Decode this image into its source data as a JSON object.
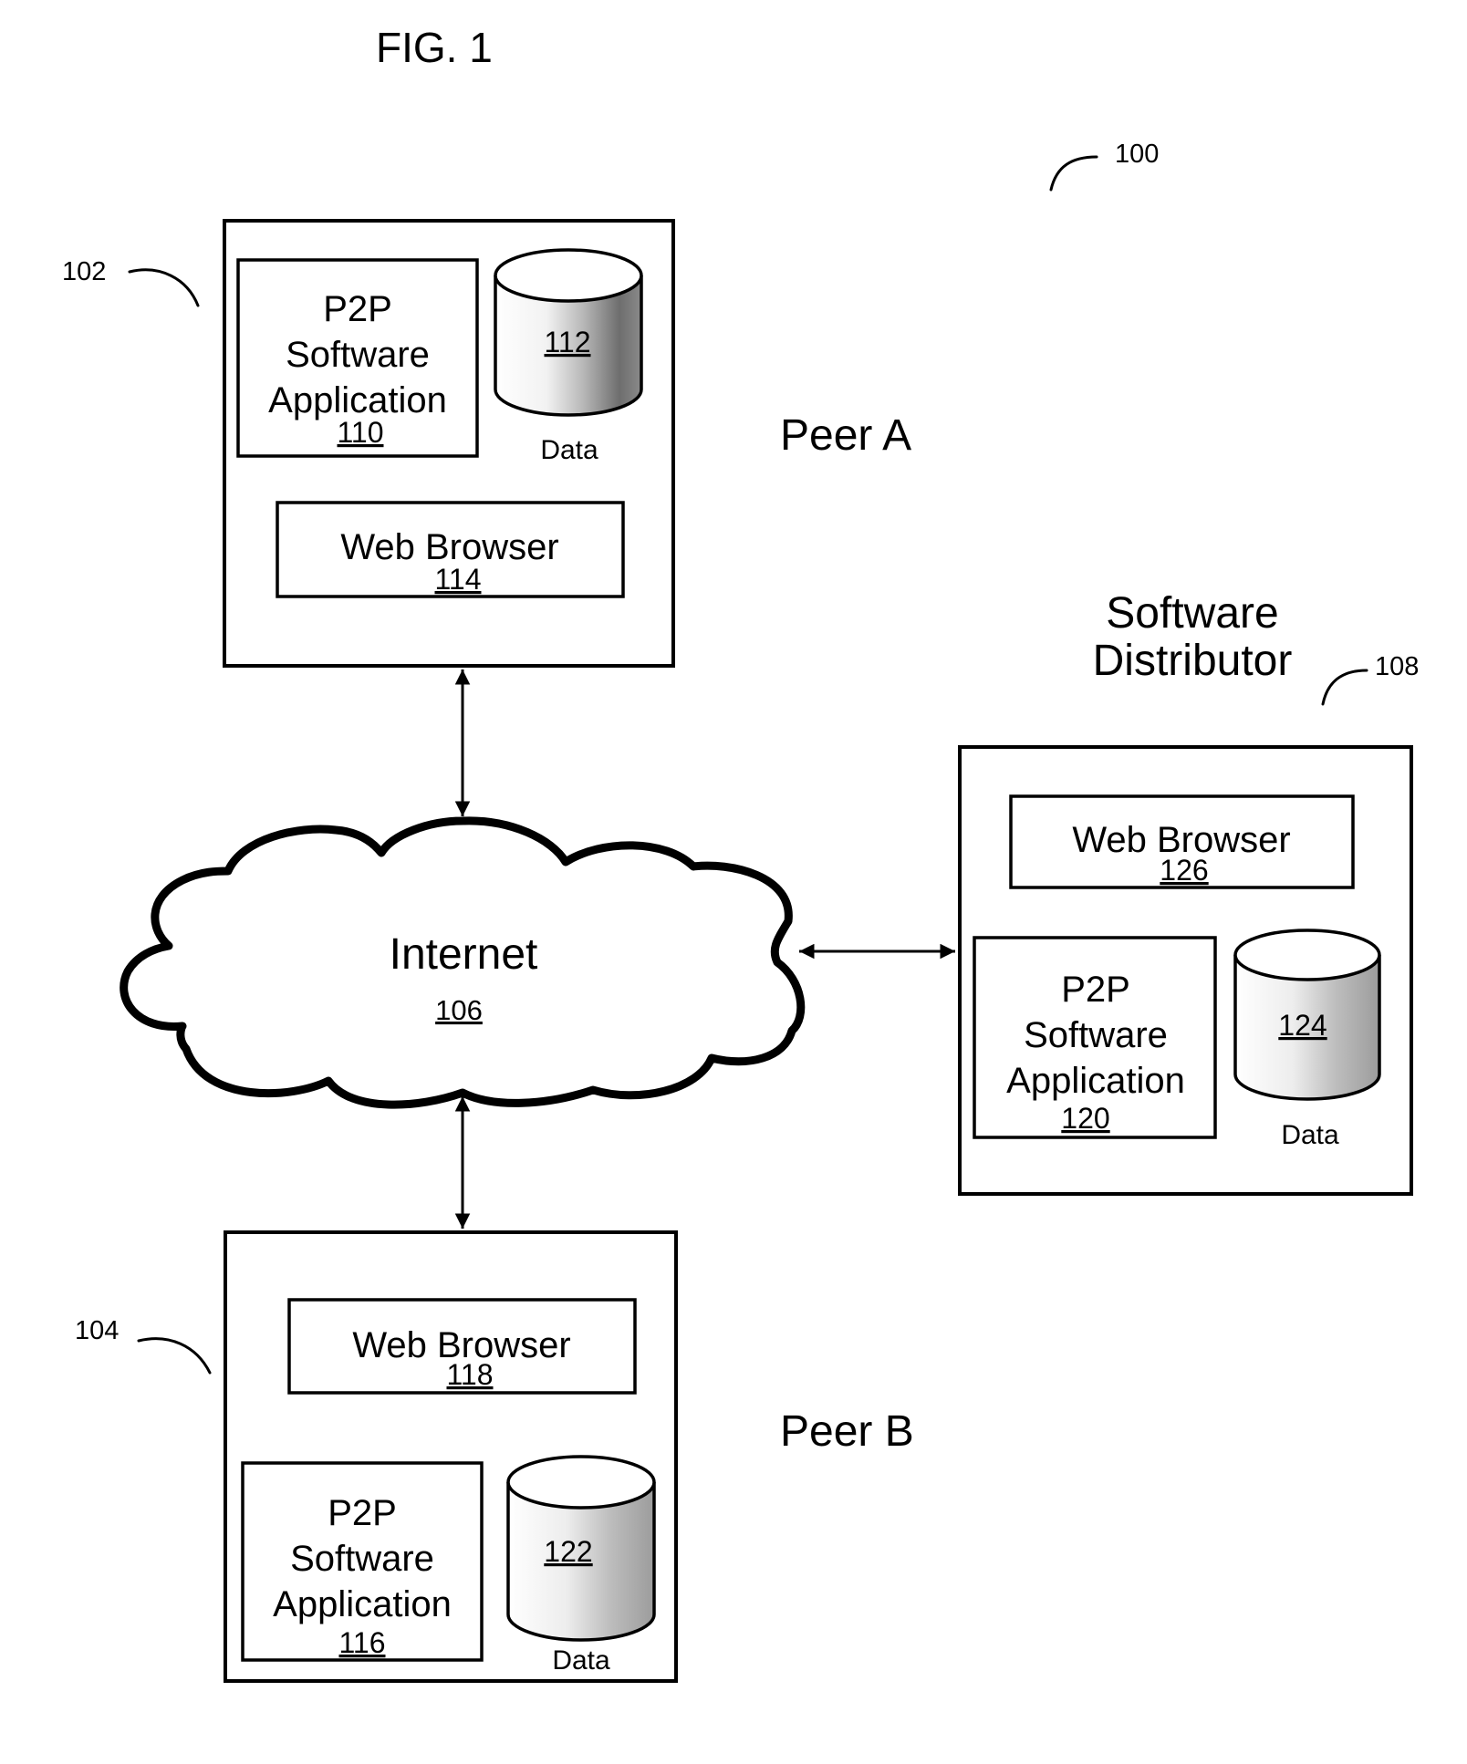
{
  "figure": {
    "title": "FIG. 1",
    "system_ref": "100"
  },
  "internet": {
    "label": "Internet",
    "ref": "106"
  },
  "peer_a": {
    "name": "Peer A",
    "ref": "102",
    "p2p_app": {
      "lines": [
        "P2P",
        "Software",
        "Application"
      ],
      "ref": "110"
    },
    "data_store": {
      "ref": "112",
      "caption": "Data"
    },
    "web_browser": {
      "label": "Web Browser",
      "ref": "114"
    }
  },
  "peer_b": {
    "name": "Peer B",
    "ref": "104",
    "web_browser": {
      "label": "Web Browser",
      "ref": "118"
    },
    "p2p_app": {
      "lines": [
        "P2P",
        "Software",
        "Application"
      ],
      "ref": "116"
    },
    "data_store": {
      "ref": "122",
      "caption": "Data"
    }
  },
  "distributor": {
    "name_lines": [
      "Software",
      "Distributor"
    ],
    "ref": "108",
    "web_browser": {
      "label": "Web Browser",
      "ref": "126"
    },
    "p2p_app": {
      "lines": [
        "P2P",
        "Software",
        "Application"
      ],
      "ref": "120"
    },
    "data_store": {
      "ref": "124",
      "caption": "Data"
    }
  },
  "connections": [
    {
      "from": "Peer A",
      "to": "Internet",
      "direction": "bidirectional"
    },
    {
      "from": "Internet",
      "to": "Software Distributor",
      "direction": "bidirectional"
    },
    {
      "from": "Internet",
      "to": "Peer B",
      "direction": "bidirectional"
    }
  ]
}
